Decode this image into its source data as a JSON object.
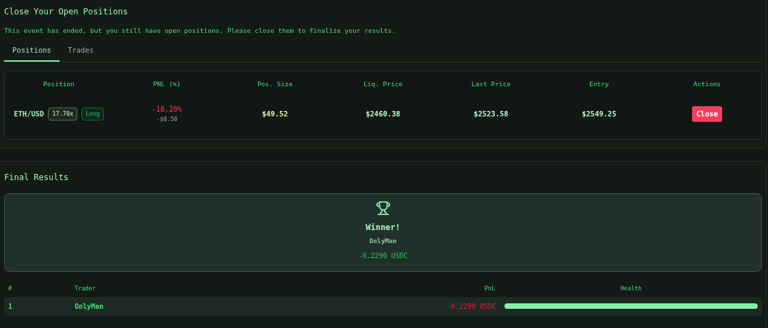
{
  "close_panel": {
    "title": "Close Your Open Positions",
    "message": "This event has ended, but you still have open positions. Please close them to finalize your results.",
    "tabs": [
      {
        "label": "Positions",
        "selected": true
      },
      {
        "label": "Trades",
        "selected": false
      }
    ],
    "table": {
      "columns": [
        "Position",
        "PNL (%)",
        "Pos. Size",
        "Liq. Price",
        "Last Price",
        "Entry",
        "Actions"
      ],
      "rows": [
        {
          "pair": "ETH/USD",
          "leverage": "17.70x",
          "side": "Long",
          "kind": "long",
          "pnl_percent": "-18.20%",
          "pnl_value": "-$0.50",
          "pos_size": "$49.52",
          "liq_price": "$2460.38",
          "last_price": "$2523.58",
          "entry": "$2549.25",
          "action": "Close"
        }
      ]
    }
  },
  "final_results": {
    "title": "Final Results",
    "winner": {
      "heading": "Winner!",
      "name": "OnlyMan",
      "amount": "-0.2290 USDC"
    },
    "leaderboard": {
      "columns": [
        "#",
        "Trader",
        "PnL",
        "Health"
      ],
      "rows": [
        {
          "rank": "1",
          "trader": "OnlyMan",
          "pnl": "-0.2290 USDC",
          "level": 1.0
        }
      ]
    }
  }
}
